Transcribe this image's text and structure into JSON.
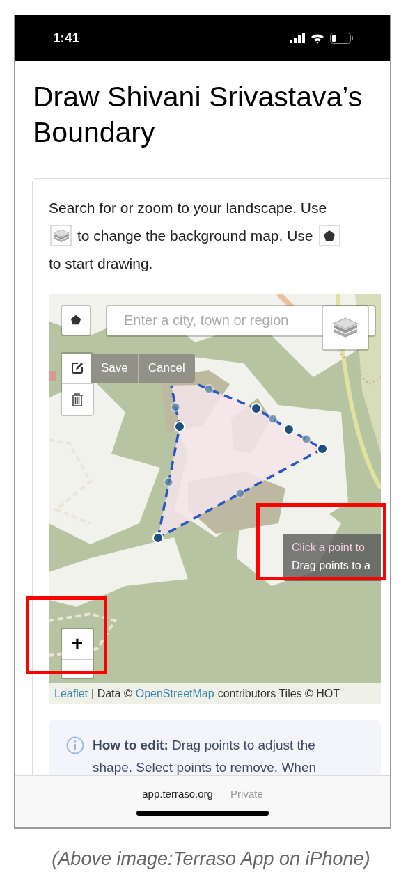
{
  "status_bar": {
    "time": "1:41"
  },
  "title": "Draw Shivani Srivastava’s Boundary",
  "instructions": {
    "before_layers": "Search for or zoom to your landscape. Use",
    "before_draw": "to change the background map. Use",
    "after_draw": "to start drawing."
  },
  "map": {
    "kind": "picture",
    "search": {
      "placeholder": "Enter a city, town or region"
    },
    "edit_actions": [
      "Save",
      "Cancel"
    ],
    "tooltip": [
      "Click a point to",
      "Drag points to a"
    ],
    "zoom_in": "+",
    "attribution": [
      {
        "kind": "link",
        "text": "Leaflet"
      },
      {
        "kind": "text",
        "text": "| Data ©"
      },
      {
        "kind": "link",
        "text": "OpenStreetMap"
      },
      {
        "kind": "text",
        "text": "contributors Tiles © HOT"
      }
    ]
  },
  "info": {
    "text": "**How to edit:** Drag points to adjust the shape. Select points to remove. When"
  },
  "browser_bar": {
    "url": "app.terraso.org",
    "privacy": "— Private"
  },
  "caption": "(Above image:Terraso App on iPhone)"
}
